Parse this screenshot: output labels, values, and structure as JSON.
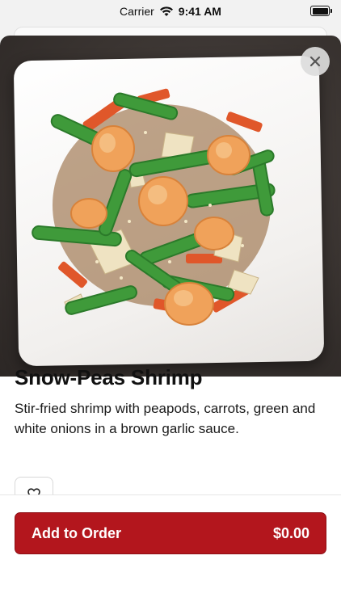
{
  "status_bar": {
    "carrier": "Carrier",
    "time": "9:41 AM"
  },
  "item": {
    "title": "Snow-Peas Shrimp",
    "description": "Stir-fried shrimp with peapods, carrots, green and white onions in a brown garlic sauce.",
    "image_subject": "plate of shrimp with snow peas, carrots and onions"
  },
  "actions": {
    "add_to_order_label": "Add to Order",
    "price": "$0.00"
  },
  "icons": {
    "close": "close-icon",
    "favorite": "heart-icon",
    "wifi": "wifi-icon",
    "battery": "battery-icon"
  },
  "colors": {
    "accent": "#b3161d",
    "background": "#ffffff"
  }
}
